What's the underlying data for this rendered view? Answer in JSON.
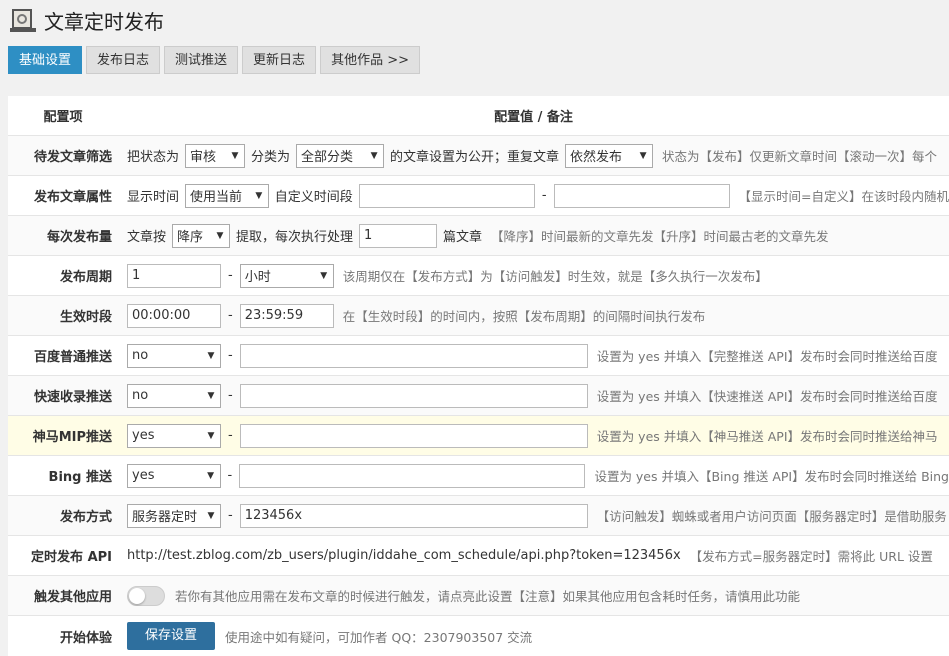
{
  "header": {
    "title": "文章定时发布"
  },
  "tabs": [
    "基础设置",
    "发布日志",
    "测试推送",
    "更新日志",
    "其他作品 >>"
  ],
  "table": {
    "col1": "配置项",
    "col2": "配置值 / 备注"
  },
  "rows": {
    "r1": {
      "label": "待发文章筛选",
      "t1": "把状态为",
      "s1": "审核",
      "t2": "分类为",
      "s2": "全部分类",
      "t3": "的文章设置为公开；重复文章",
      "s3": "依然发布",
      "note": "状态为【发布】仅更新文章时间【滚动一次】每个"
    },
    "r2": {
      "label": "发布文章属性",
      "t1": "显示时间",
      "s1": "使用当前",
      "t2": "自定义时间段",
      "dash": "-",
      "note": "【显示时间=自定义】在该时段内随机"
    },
    "r3": {
      "label": "每次发布量",
      "t1": "文章按",
      "s1": "降序",
      "t2": "提取，每次执行处理",
      "v1": "1",
      "t3": "篇文章",
      "note": "【降序】时间最新的文章先发【升序】时间最古老的文章先发"
    },
    "r4": {
      "label": "发布周期",
      "v1": "1",
      "dash": "-",
      "s1": "小时",
      "note": "该周期仅在【发布方式】为【访问触发】时生效，就是【多久执行一次发布】"
    },
    "r5": {
      "label": "生效时段",
      "v1": "00:00:00",
      "dash": "-",
      "v2": "23:59:59",
      "note": "在【生效时段】的时间内，按照【发布周期】的间隔时间执行发布"
    },
    "r6": {
      "label": "百度普通推送",
      "s1": "no",
      "dash": "-",
      "note": "设置为 yes 并填入【完整推送 API】发布时会同时推送给百度"
    },
    "r7": {
      "label": "快速收录推送",
      "s1": "no",
      "dash": "-",
      "note": "设置为 yes 并填入【快速推送 API】发布时会同时推送给百度"
    },
    "r8": {
      "label": "神马MIP推送",
      "s1": "yes",
      "dash": "-",
      "note": "设置为 yes 并填入【神马推送 API】发布时会同时推送给神马"
    },
    "r9": {
      "label": "Bing 推送",
      "s1": "yes",
      "dash": "-",
      "note": "设置为 yes 并填入【Bing 推送 API】发布时会同时推送给 Bing"
    },
    "r10": {
      "label": "发布方式",
      "s1": "服务器定时",
      "dash": "-",
      "v1": "123456x",
      "note": "【访问触发】蜘蛛或者用户访问页面【服务器定时】是借助服务"
    },
    "r11": {
      "label": "定时发布 API",
      "url": "http://test.zblog.com/zb_users/plugin/iddahe_com_schedule/api.php?token=123456x",
      "note": "【发布方式=服务器定时】需将此 URL 设置"
    },
    "r12": {
      "label": "触发其他应用",
      "note": "若你有其他应用需在发布文章的时候进行触发，请点亮此设置【注意】如果其他应用包含耗时任务，请慎用此功能"
    },
    "r13": {
      "label": "开始体验",
      "btn": "保存设置",
      "note": "使用途中如有疑问，可加作者 QQ：2307903507 交流"
    }
  }
}
